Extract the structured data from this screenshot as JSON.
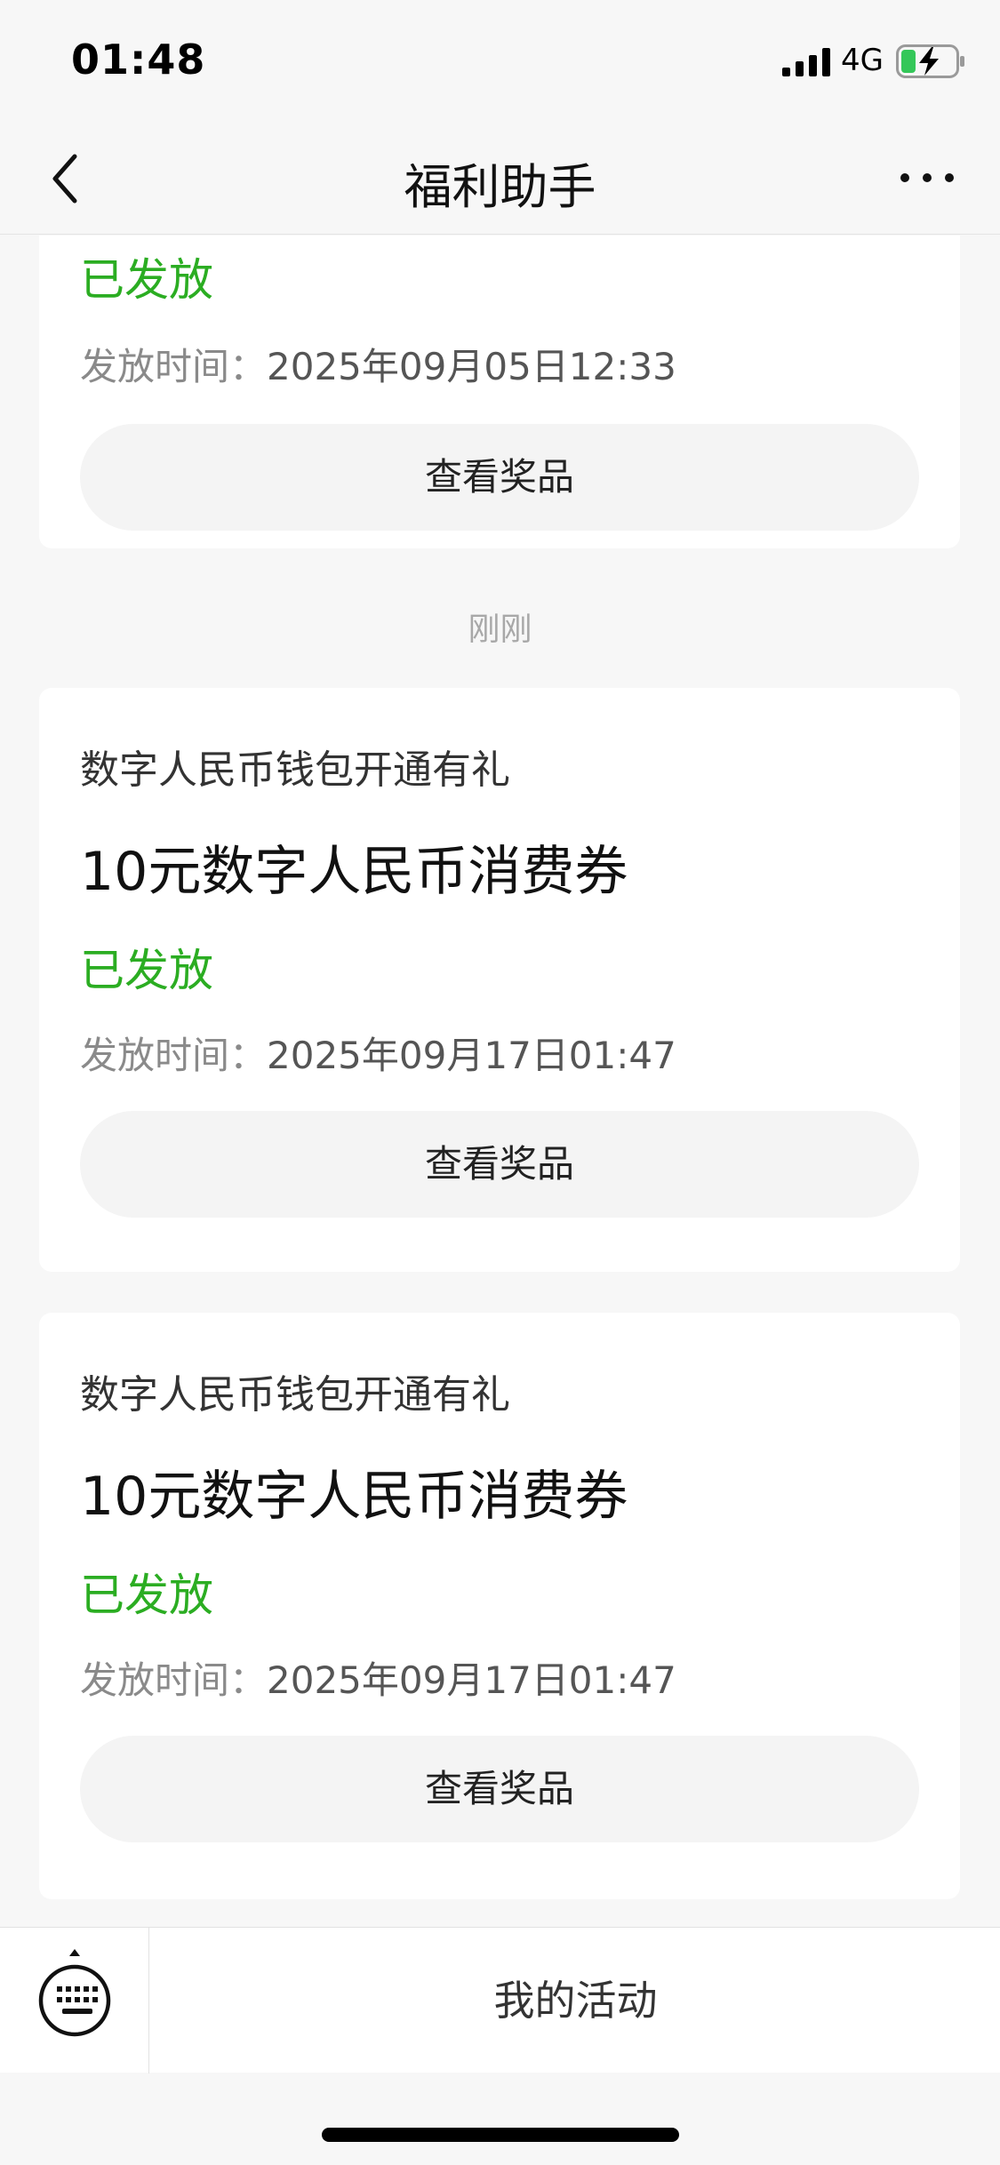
{
  "status_bar": {
    "time": "01:48",
    "network": "4G",
    "signal_icon": "signal-bars-icon",
    "battery_icon": "battery-charging-icon"
  },
  "nav": {
    "title": "福利助手",
    "back_icon": "chevron-left-icon",
    "more_icon": "more-dots-icon"
  },
  "partial_card": {
    "status": "已发放",
    "time_label": "发放时间：",
    "time_value": "2025年09月05日12:33",
    "button_label": "查看奖品"
  },
  "divider": "刚刚",
  "cards": [
    {
      "source": "数字人民币钱包开通有礼",
      "title": "10元数字人民币消费券",
      "status": "已发放",
      "time_label": "发放时间：",
      "time_value": "2025年09月17日01:47",
      "button_label": "查看奖品"
    },
    {
      "source": "数字人民币钱包开通有礼",
      "title": "10元数字人民币消费券",
      "status": "已发放",
      "time_label": "发放时间：",
      "time_value": "2025年09月17日01:47",
      "button_label": "查看奖品"
    }
  ],
  "bottom_bar": {
    "keyboard_icon": "keyboard-icon",
    "activity_label": "我的活动"
  },
  "colors": {
    "status_green": "#2bad22",
    "background": "#f7f7f7"
  }
}
